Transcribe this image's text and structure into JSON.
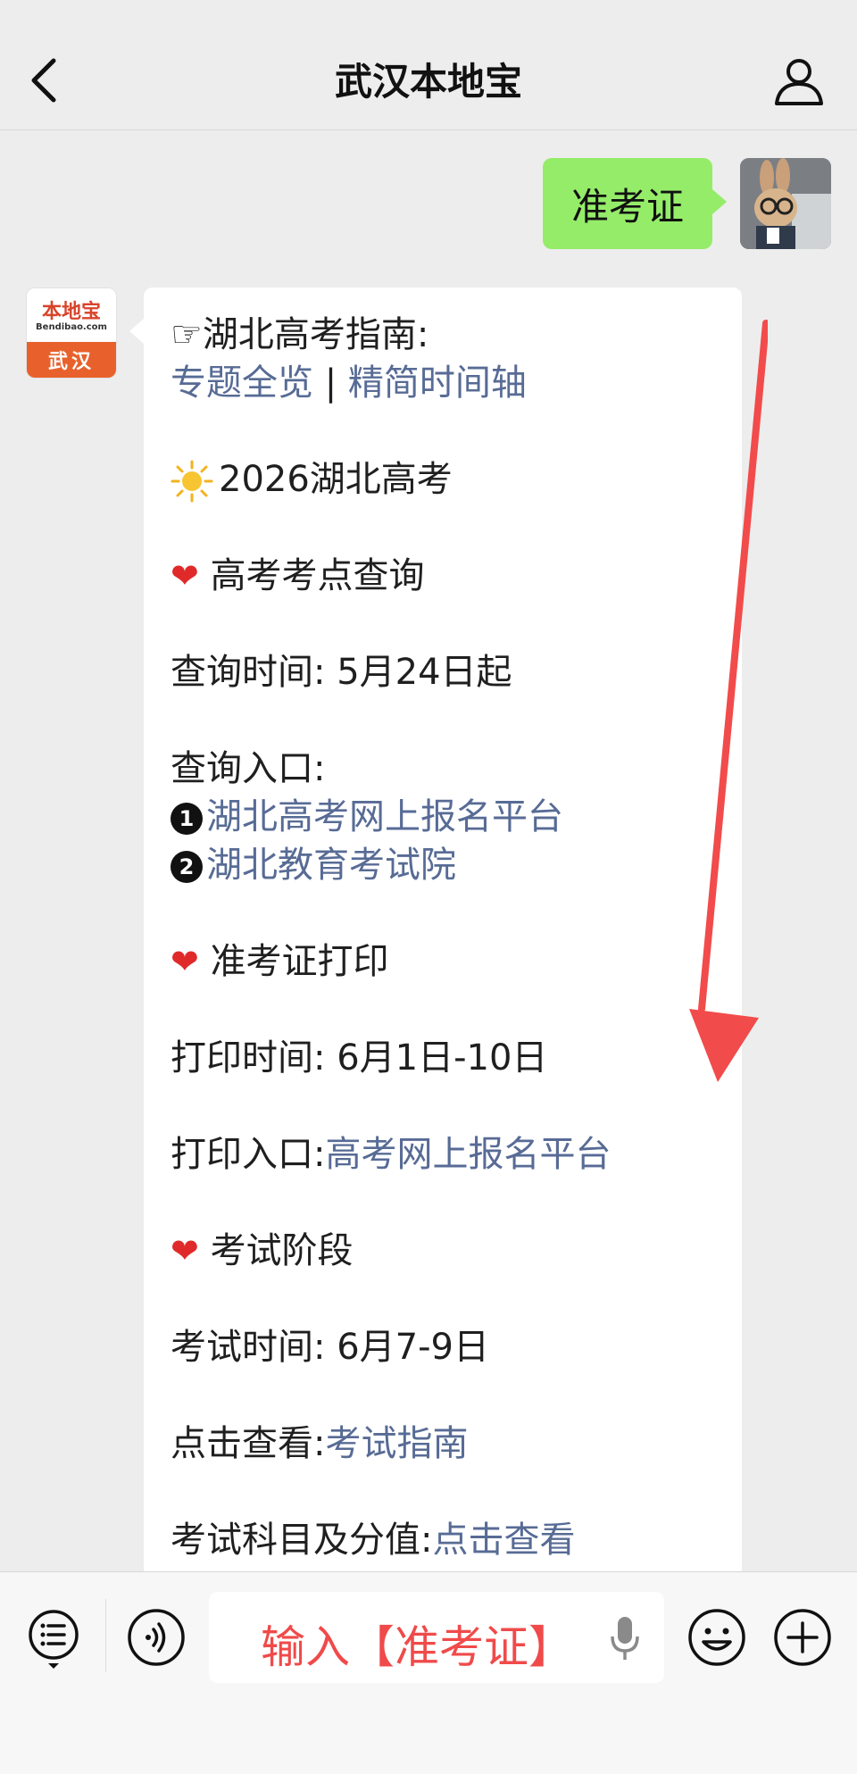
{
  "header": {
    "title": "武汉本地宝"
  },
  "user_message": {
    "text": "准考证"
  },
  "official_account": {
    "logo_text": "本地宝",
    "logo_sub": "Bendibao.com",
    "city": "武汉"
  },
  "reply": {
    "guide_prefix": "☞湖北高考指南:",
    "link_overview": "专题全览",
    "separator": " | ",
    "link_timeline": "精简时间轴",
    "year_title": "2026湖北高考",
    "section1_title": "高考考点查询",
    "query_time_label": "查询时间:",
    "query_time_value": "5月24日起",
    "query_entry_label": "查询入口:",
    "entry1_num": "1",
    "entry1_link": "湖北高考网上报名平台",
    "entry2_num": "2",
    "entry2_link": "湖北教育考试院",
    "section2_title": "准考证打印",
    "print_time_label": "打印时间:",
    "print_time_value": "6月1日-10日",
    "print_entry_label": "打印入口:",
    "print_entry_link": "高考网上报名平台",
    "section3_title": "考试阶段",
    "exam_time_label": "考试时间:",
    "exam_time_value": "6月7-9日",
    "view_label": "点击查看:",
    "view_link": "考试指南",
    "subjects_label": "考试科目及分值:",
    "subjects_link": "点击查看"
  },
  "input_bar": {
    "text": "输入【准考证】"
  },
  "colors": {
    "user_bubble": "#95ec69",
    "link": "#576b95",
    "heart": "#e02a2a",
    "input_hint": "#f04a4a",
    "arrow": "#f24b4b"
  }
}
